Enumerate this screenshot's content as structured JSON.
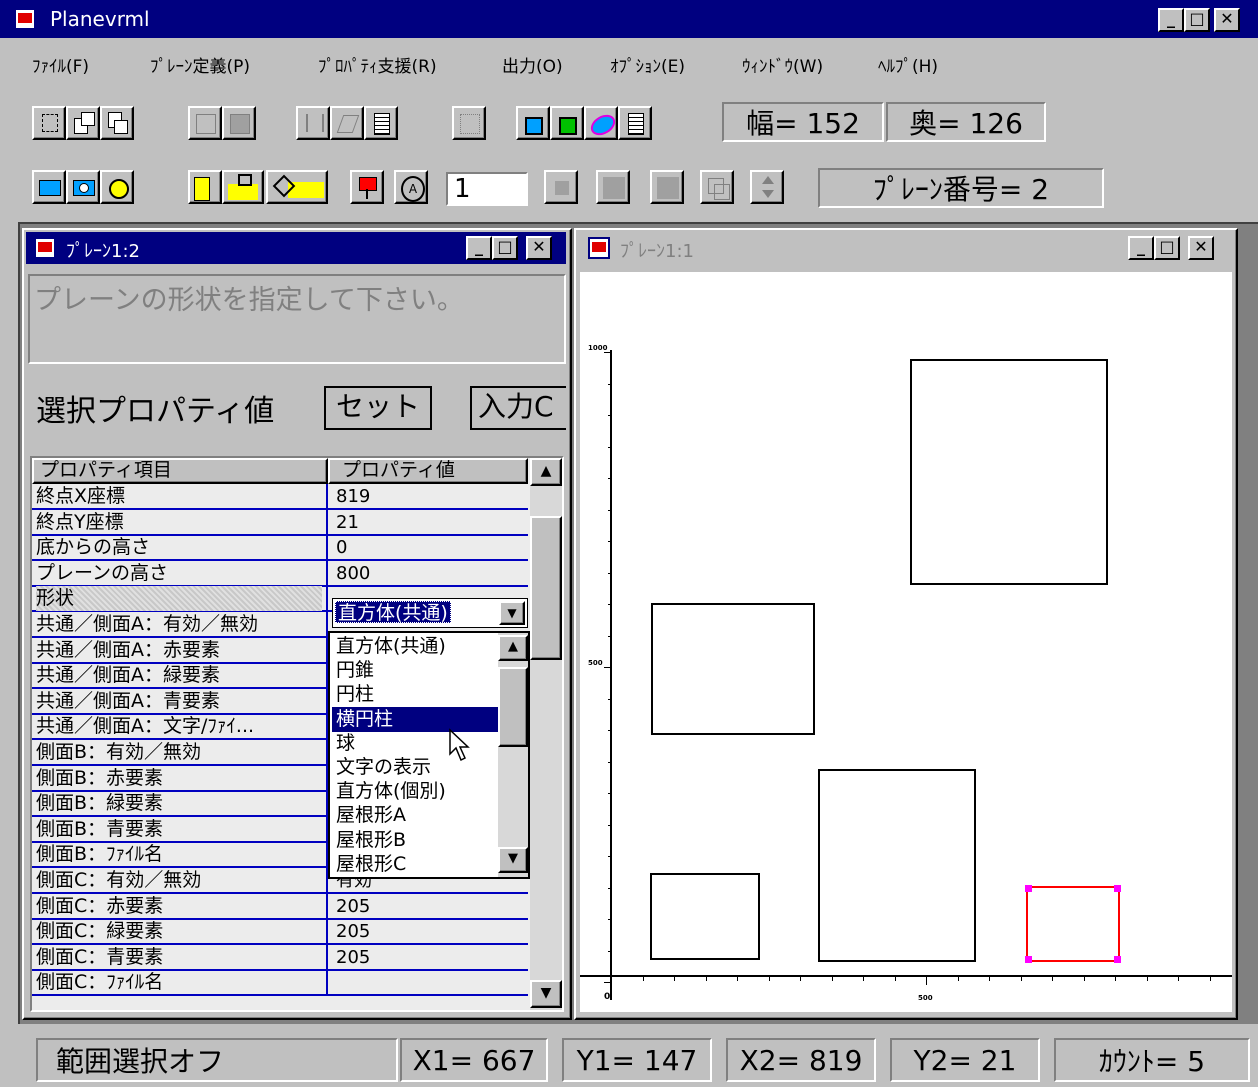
{
  "app": {
    "title": "Planevrml"
  },
  "menu": [
    "ﾌｧｲﾙ(F)",
    "ﾌﾟﾚｰﾝ定義(P)",
    "ﾌﾟﾛﾊﾟﾃｨ支援(R)",
    "出力(O)",
    "ｵﾌﾟｼｮﾝ(E)",
    "ｳｨﾝﾄﾞｳ(W)",
    "ﾍﾙﾌﾟ(H)"
  ],
  "toolbar": {
    "width_label": "幅= 152",
    "depth_label": "奥= 126",
    "number_value": "1",
    "plane_number_label": "ﾌﾟﾚｰﾝ番号= 2"
  },
  "prop_window": {
    "title": "ﾌﾟﾚｰﾝ1:2",
    "hint": "プレーンの形状を指定して下さい。",
    "selected_label": "選択プロパティ値",
    "set_button": "セット",
    "input_button": "入力C",
    "col_item": "プロパティ項目",
    "col_value": "プロパティ値",
    "rows": [
      {
        "item": "終点X座標",
        "value": "819"
      },
      {
        "item": "終点Y座標",
        "value": "21"
      },
      {
        "item": "底からの高さ",
        "value": "0"
      },
      {
        "item": "プレーンの高さ",
        "value": "800"
      },
      {
        "item": "形状",
        "value": ""
      },
      {
        "item": "共通／側面A：有効／無効",
        "value": ""
      },
      {
        "item": "共通／側面A：赤要素",
        "value": ""
      },
      {
        "item": "共通／側面A：緑要素",
        "value": ""
      },
      {
        "item": "共通／側面A：青要素",
        "value": ""
      },
      {
        "item": "共通／側面A：文字/ﾌｧｲ...",
        "value": ""
      },
      {
        "item": "側面B：有効／無効",
        "value": ""
      },
      {
        "item": "側面B：赤要素",
        "value": ""
      },
      {
        "item": "側面B：緑要素",
        "value": ""
      },
      {
        "item": "側面B：青要素",
        "value": ""
      },
      {
        "item": "側面B：ﾌｧｲﾙ名",
        "value": ""
      },
      {
        "item": "側面C：有効／無効",
        "value": "有効"
      },
      {
        "item": "側面C：赤要素",
        "value": "205"
      },
      {
        "item": "側面C：緑要素",
        "value": "205"
      },
      {
        "item": "側面C：青要素",
        "value": "205"
      },
      {
        "item": "側面C：ﾌｧｲﾙ名",
        "value": ""
      }
    ],
    "shape_combo": "直方体(共通)",
    "shape_options": [
      "直方体(共通)",
      "円錐",
      "円柱",
      "横円柱",
      "球",
      "文字の表示",
      "直方体(個別)",
      "屋根形A",
      "屋根形B",
      "屋根形C"
    ],
    "shape_selected": "横円柱"
  },
  "plane_window": {
    "title": "ﾌﾟﾚｰﾝ1:1",
    "y_tick_1000": "1000",
    "y_tick_500": "500",
    "x_tick_500": "500",
    "x_origin": "0"
  },
  "status": {
    "range": "範囲選択オフ",
    "x1": "X1= 667",
    "y1": "Y1= 147",
    "x2": "X2= 819",
    "y2": "Y2=  21",
    "count": "ｶｳﾝﾄ=  5"
  },
  "colors": {
    "title_active": "#000080",
    "selection": "#000080",
    "grid_line": "#0000c0",
    "selected_shape": "#ff0000",
    "handle": "#ff00ff"
  }
}
